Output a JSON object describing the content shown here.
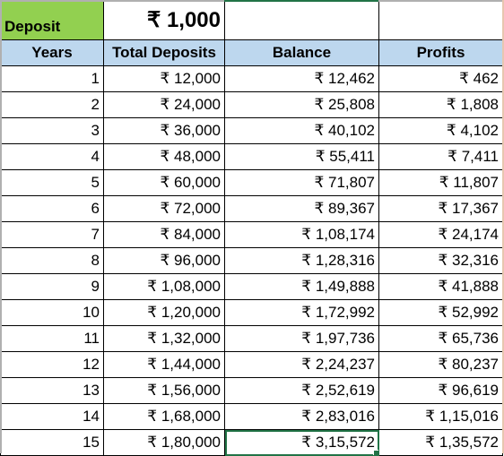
{
  "deposit": {
    "label": "Deposit",
    "value": "₹ 1,000"
  },
  "table": {
    "columns": [
      "Years",
      "Total Deposits",
      "Balance",
      "Profits"
    ],
    "rows": [
      {
        "year": "1",
        "total_deposits": "₹ 12,000",
        "balance": "₹ 12,462",
        "profits": "₹ 462"
      },
      {
        "year": "2",
        "total_deposits": "₹ 24,000",
        "balance": "₹ 25,808",
        "profits": "₹ 1,808"
      },
      {
        "year": "3",
        "total_deposits": "₹ 36,000",
        "balance": "₹ 40,102",
        "profits": "₹ 4,102"
      },
      {
        "year": "4",
        "total_deposits": "₹ 48,000",
        "balance": "₹ 55,411",
        "profits": "₹ 7,411"
      },
      {
        "year": "5",
        "total_deposits": "₹ 60,000",
        "balance": "₹ 71,807",
        "profits": "₹ 11,807"
      },
      {
        "year": "6",
        "total_deposits": "₹ 72,000",
        "balance": "₹ 89,367",
        "profits": "₹ 17,367"
      },
      {
        "year": "7",
        "total_deposits": "₹ 84,000",
        "balance": "₹ 1,08,174",
        "profits": "₹ 24,174"
      },
      {
        "year": "8",
        "total_deposits": "₹ 96,000",
        "balance": "₹ 1,28,316",
        "profits": "₹ 32,316"
      },
      {
        "year": "9",
        "total_deposits": "₹ 1,08,000",
        "balance": "₹ 1,49,888",
        "profits": "₹ 41,888"
      },
      {
        "year": "10",
        "total_deposits": "₹ 1,20,000",
        "balance": "₹ 1,72,992",
        "profits": "₹ 52,992"
      },
      {
        "year": "11",
        "total_deposits": "₹ 1,32,000",
        "balance": "₹ 1,97,736",
        "profits": "₹ 65,736"
      },
      {
        "year": "12",
        "total_deposits": "₹ 1,44,000",
        "balance": "₹ 2,24,237",
        "profits": "₹ 80,237"
      },
      {
        "year": "13",
        "total_deposits": "₹ 1,56,000",
        "balance": "₹ 2,52,619",
        "profits": "₹ 96,619"
      },
      {
        "year": "14",
        "total_deposits": "₹ 1,68,000",
        "balance": "₹ 2,83,016",
        "profits": "₹ 1,15,016"
      },
      {
        "year": "15",
        "total_deposits": "₹ 1,80,000",
        "balance": "₹ 3,15,572",
        "profits": "₹ 1,35,572"
      }
    ]
  },
  "colors": {
    "deposit_label_fill": "#92d050",
    "header_fill": "#bdd7ee",
    "selection_border": "#217346"
  }
}
